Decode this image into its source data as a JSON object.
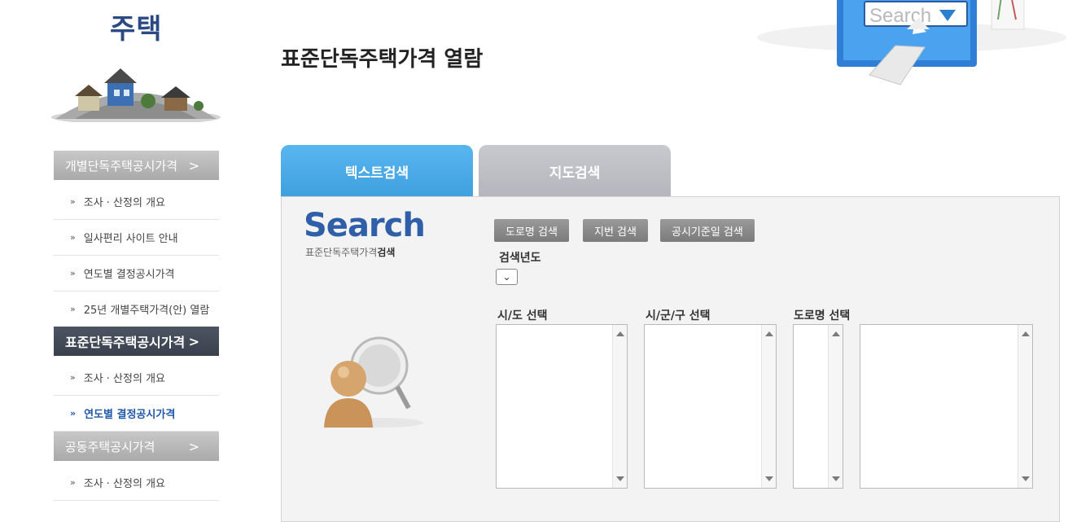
{
  "sidebar": {
    "title": "주택",
    "sections": [
      {
        "label": "개별단독주택공시가격",
        "chevron": ">"
      },
      {
        "label": "표준단독주택공시가격",
        "chevron": ">"
      },
      {
        "label": "공동주택공시가격",
        "chevron": ">"
      }
    ],
    "items_section1": [
      {
        "label": "조사 · 산정의 개요"
      },
      {
        "label": "일사편리 사이트 안내"
      },
      {
        "label": "연도별 결정공시가격"
      },
      {
        "label": "25년 개별주택가격(안) 열람"
      }
    ],
    "items_section2": [
      {
        "label": "조사 · 산정의 개요"
      },
      {
        "label": "연도별 결정공시가격"
      }
    ],
    "items_section3": [
      {
        "label": "조사 · 산정의 개요"
      }
    ],
    "bullet": "»"
  },
  "header": {
    "title": "표준단독주택가격 열람",
    "hero_search_word": "Search"
  },
  "tabs": [
    {
      "label": "텍스트검색",
      "active": true
    },
    {
      "label": "지도검색",
      "active": false
    }
  ],
  "panel": {
    "logo": "Search",
    "subtitle_a": "표준단독주택가격",
    "subtitle_b": "검색",
    "buttons": [
      {
        "label": "도로명 검색"
      },
      {
        "label": "지번 검색"
      },
      {
        "label": "공시기준일 검색"
      }
    ],
    "year_label": "검색년도",
    "year_select_icon": "chevron-down",
    "list_labels": {
      "sido": "시/도 선택",
      "sigungu": "시/군/구 선택",
      "road": "도로명 선택"
    }
  },
  "colors": {
    "accent_blue": "#3fa0df",
    "brand_navy": "#2b4a84",
    "active_menu": "#3a404c",
    "button_gray": "#888888"
  }
}
